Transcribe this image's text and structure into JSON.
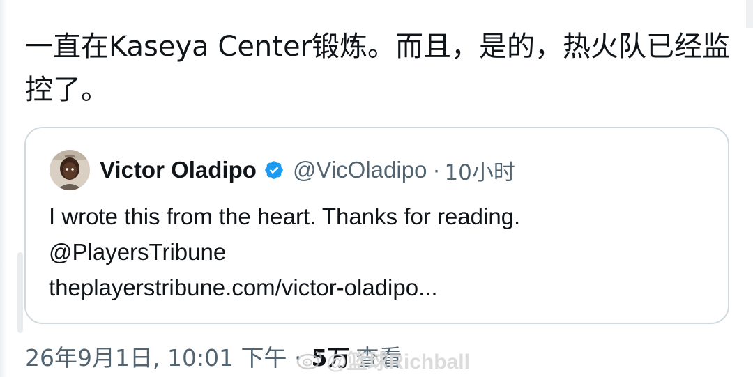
{
  "tweet": {
    "text": "一直在Kaseya Center锻炼。而且，是的，热火队已经监控了。"
  },
  "quoted_tweet": {
    "display_name": "Victor Oladipo",
    "handle": "@VicOladipo",
    "separator": "·",
    "time": "10小时",
    "verified_color": "#1d9bf0",
    "lines": [
      "I wrote this from the heart. Thanks for reading.",
      "@PlayersTribune",
      "theplayerstribune.com/victor-oladipo..."
    ]
  },
  "meta": {
    "timestamp": "26年9月1日, 10:01 下午 ·",
    "views_count": "5万",
    "views_label": "查看"
  },
  "watermark": {
    "text": "@篮球Richball",
    "icon": "weibo-icon"
  },
  "colors": {
    "primary_text": "#0f1419",
    "secondary_text": "#536471",
    "border": "#cfd9de",
    "verified": "#1d9bf0"
  }
}
